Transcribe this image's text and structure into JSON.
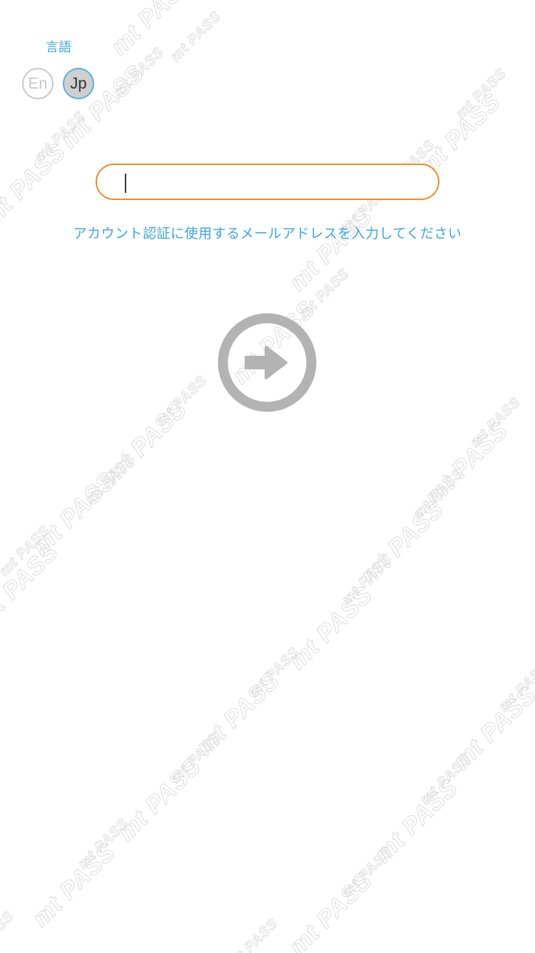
{
  "language": {
    "label": "言語",
    "options": [
      {
        "label": "En",
        "selected": false
      },
      {
        "label": "Jp",
        "selected": true
      }
    ]
  },
  "email": {
    "value": "",
    "placeholder": ""
  },
  "hint_text": "アカウント認証に使用するメールアドレスを入力してください",
  "submit": {
    "icon": "arrow-right-circle-icon"
  },
  "watermark": {
    "text": "mt PASS"
  },
  "colors": {
    "accent_blue": "#3aa8e0",
    "input_border": "#f08a24",
    "icon_gray": "#b3b3b3"
  }
}
